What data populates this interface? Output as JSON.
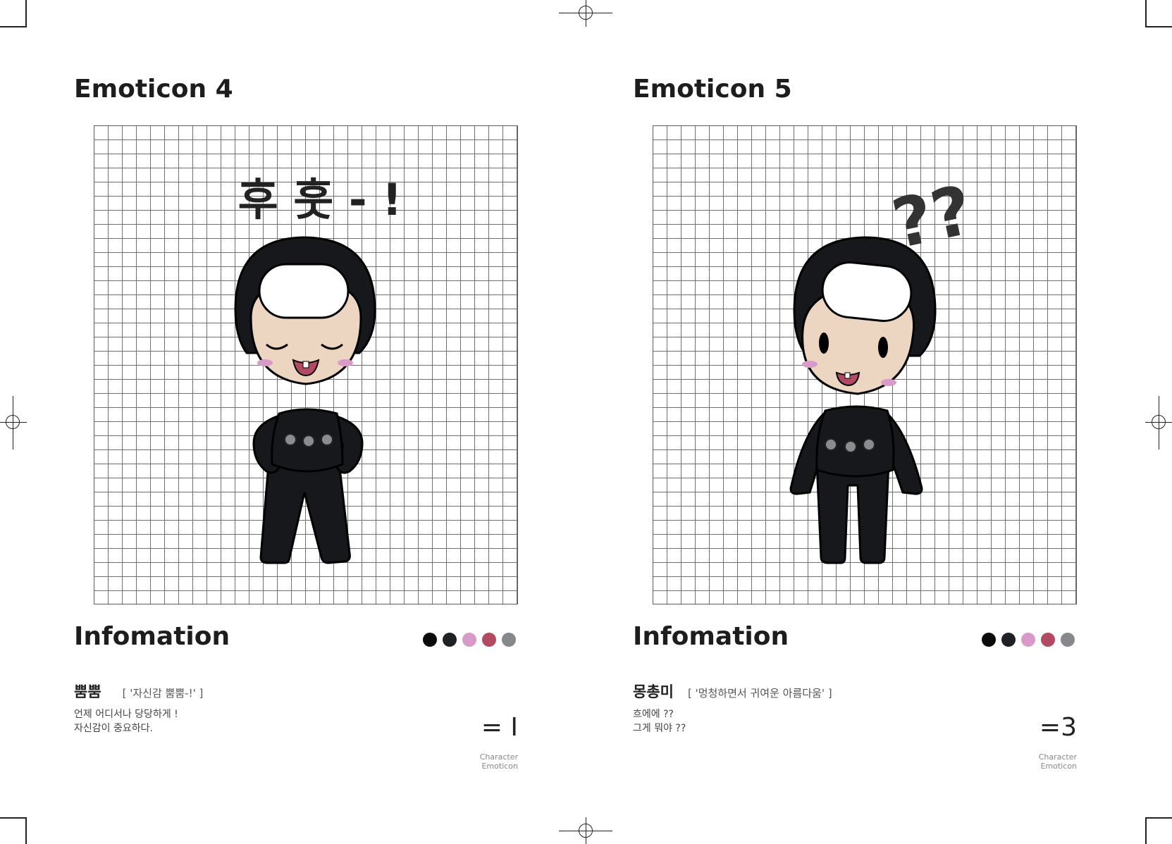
{
  "left": {
    "title": "Emoticon 4",
    "info_title": "Infomation",
    "name": "뿜뿜",
    "quote": "[ '자신감 뿜뿜-!' ]",
    "description": "언제 어디서나 당당하게 !\n자신감이 중요하다.",
    "rank": "= I",
    "rank_caption": "Character\nEmoticon",
    "bubble_text": "후 훗 - !",
    "palette": [
      "#0b0b0b",
      "#1f2124",
      "#d99ac9",
      "#b24a63",
      "#86888b"
    ]
  },
  "right": {
    "title": "Emoticon 5",
    "info_title": "Infomation",
    "name": "몽총미",
    "quote": "[ '멍청하면서 귀여운 아름다움' ]",
    "description": "흐에에 ??\n그게 뭐야 ??",
    "rank": "=3",
    "rank_caption": "Character\nEmoticon",
    "bubble_text": "??",
    "palette": [
      "#0b0b0b",
      "#1f2124",
      "#d99ac9",
      "#b24a63",
      "#86888b"
    ]
  }
}
